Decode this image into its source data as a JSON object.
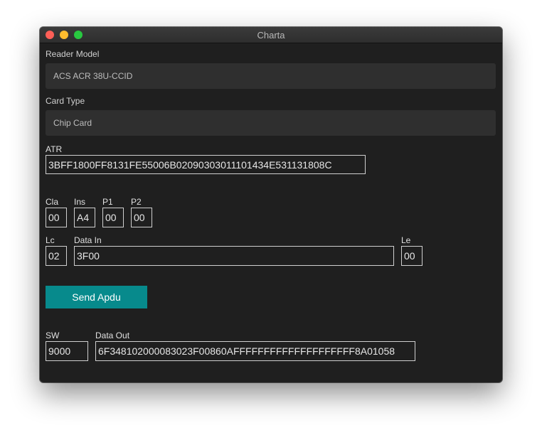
{
  "window": {
    "title": "Charta"
  },
  "reader": {
    "label": "Reader Model",
    "value": "ACS ACR 38U-CCID"
  },
  "card": {
    "label": "Card Type",
    "value": "Chip Card"
  },
  "atr": {
    "label": "ATR",
    "value": "3BFF1800FF8131FE55006B02090303011101434E531131808C"
  },
  "apdu": {
    "cla": {
      "label": "Cla",
      "value": "00"
    },
    "ins": {
      "label": "Ins",
      "value": "A4"
    },
    "p1": {
      "label": "P1",
      "value": "00"
    },
    "p2": {
      "label": "P2",
      "value": "00"
    },
    "lc": {
      "label": "Lc",
      "value": "02"
    },
    "data_in": {
      "label": "Data In",
      "value": "3F00"
    },
    "le": {
      "label": "Le",
      "value": "00"
    }
  },
  "send_button": {
    "label": "Send Apdu"
  },
  "response": {
    "sw": {
      "label": "SW",
      "value": "9000"
    },
    "data_out": {
      "label": "Data Out",
      "value": "6F348102000083023F00860AFFFFFFFFFFFFFFFFFFFF8A01058"
    }
  },
  "colors": {
    "accent": "#078a8c",
    "background": "#1f1f1f",
    "field_bg": "#2f2f2f"
  }
}
